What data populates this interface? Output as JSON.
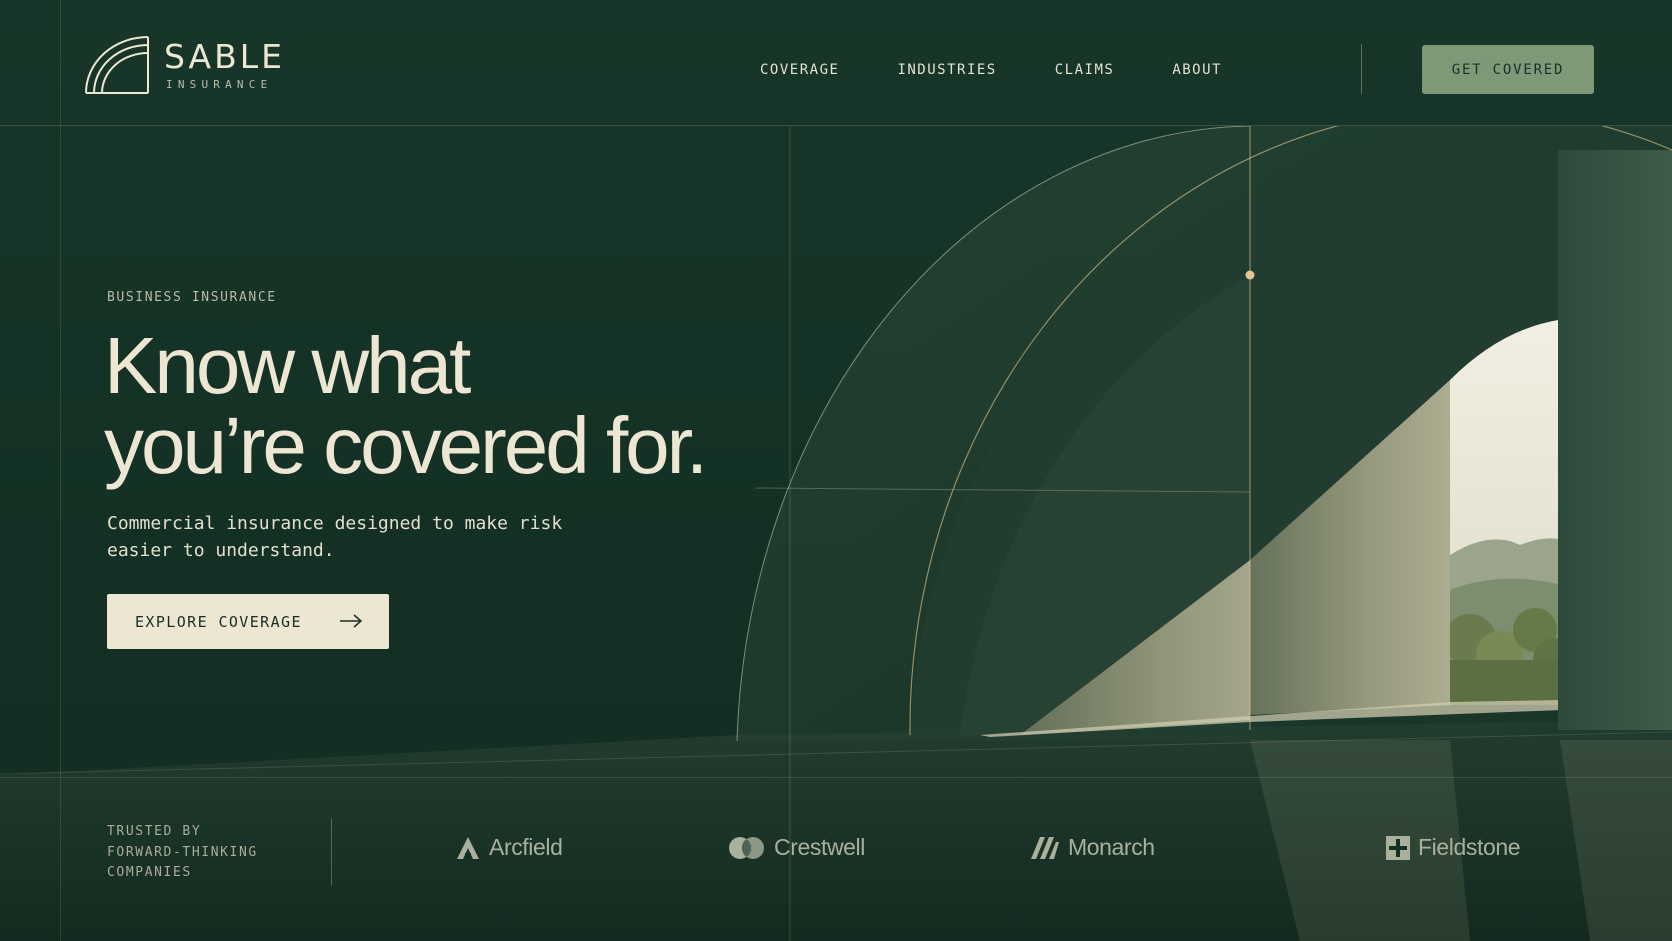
{
  "brand": {
    "name": "SABLE",
    "tagline": "INSURANCE"
  },
  "nav": {
    "items": [
      {
        "label": "COVERAGE"
      },
      {
        "label": "INDUSTRIES"
      },
      {
        "label": "CLAIMS"
      },
      {
        "label": "ABOUT"
      }
    ],
    "cta_label": "GET COVERED"
  },
  "hero": {
    "eyebrow": "BUSINESS INSURANCE",
    "headline_line1": "Know what",
    "headline_line2": "you’re covered for.",
    "subcopy": "Commercial insurance designed to make risk easier to understand.",
    "cta_label": "EXPLORE COVERAGE",
    "cta_icon": "arrow-right-icon"
  },
  "trusted": {
    "label_lines": [
      "TRUSTED BY",
      "FORWARD-THINKING",
      "COMPANIES"
    ],
    "logos": [
      {
        "name": "Arcfield",
        "icon": "arcfield-logo-icon"
      },
      {
        "name": "Crestwell",
        "icon": "crestwell-logo-icon"
      },
      {
        "name": "Monarch",
        "icon": "monarch-logo-icon"
      },
      {
        "name": "Fieldstone",
        "icon": "fieldstone-logo-icon"
      }
    ]
  },
  "colors": {
    "background": "#163326",
    "cream": "#ece6d3",
    "sage_button": "#7f9878",
    "accent_dot": "#e2c993"
  }
}
